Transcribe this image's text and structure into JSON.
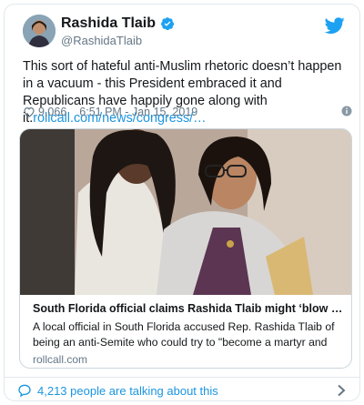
{
  "author": {
    "name": "Rashida Tlaib",
    "handle": "@RashidaTlaib"
  },
  "tweet": {
    "text": "This sort of hateful anti-Muslim rhetoric doesn’t happen in a vacuum - this President embraced it and Republicans have happily gone along with it.",
    "link": "rollcall.com/news/congress/…"
  },
  "meta": {
    "likes": "9,066",
    "timestamp": "6:51 PM - Jan 15, 2019"
  },
  "card": {
    "title": "South Florida official claims Rashida Tlaib might ‘blow up’ Ca…",
    "description": "A local official in South Florida accused Rep. Rashida Tlaib of being an anti-Semite who could try to \"become a martyr and blow up",
    "domain": "rollcall.com"
  },
  "footer": {
    "talking": "4,213 people are talking about this"
  },
  "colors": {
    "link": "#1b95e0",
    "twitter_blue": "#1da1f2",
    "secondary_text": "#657786"
  },
  "icons": [
    "verified-badge-icon",
    "twitter-bird-icon",
    "heart-icon",
    "info-icon",
    "speech-bubble-icon",
    "chevron-right-icon"
  ]
}
